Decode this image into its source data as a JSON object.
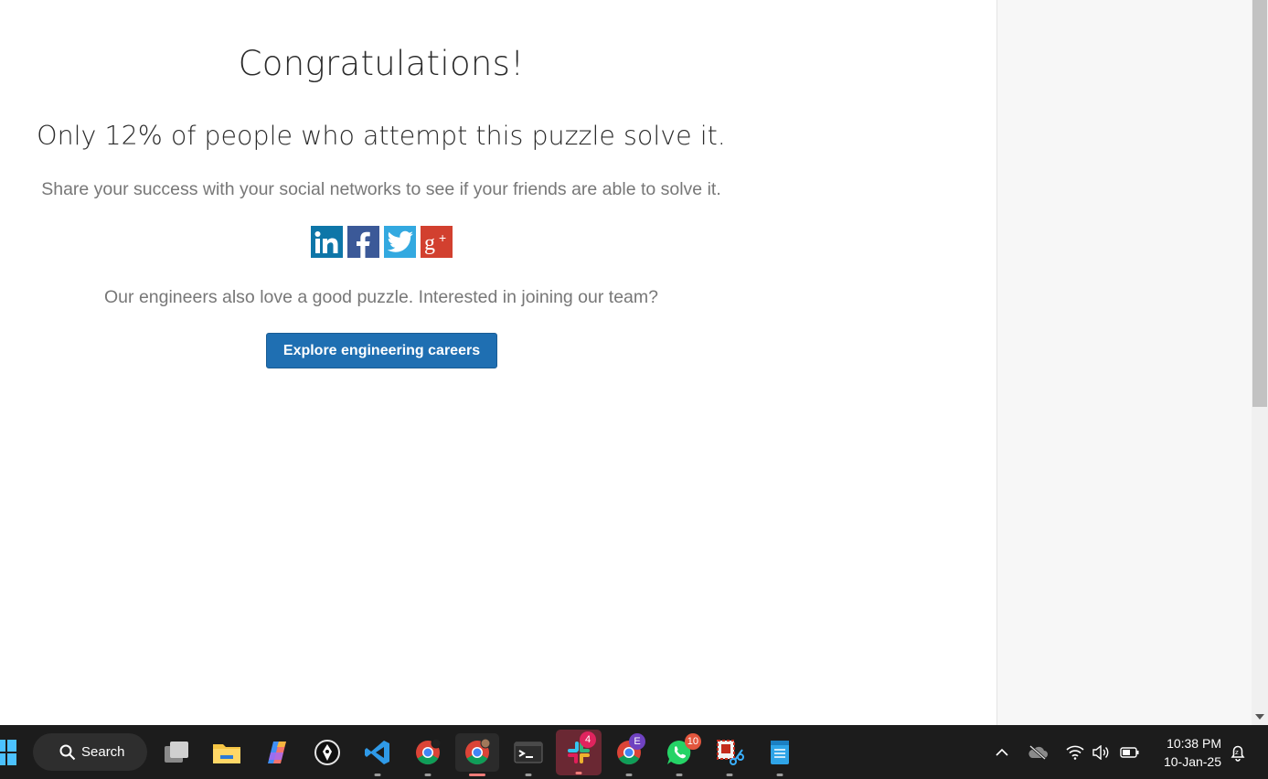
{
  "page": {
    "heading": "Congratulations!",
    "sub_heading": "Only 12% of people who attempt this puzzle solve it.",
    "share_text": "Share your success with your social networks to see if your friends are able to solve it.",
    "team_text": "Our engineers also love a good puzzle. Interested in joining our team?",
    "careers_button": "Explore engineering careers",
    "social": [
      {
        "icon": "linkedin-icon",
        "label": "in",
        "color": "#0e76a8"
      },
      {
        "icon": "facebook-icon",
        "label": "f",
        "color": "#3b5998"
      },
      {
        "icon": "twitter-icon",
        "label": "",
        "color": "#33a9e0"
      },
      {
        "icon": "google-plus-icon",
        "label": "g+",
        "color": "#d2402f"
      }
    ]
  },
  "taskbar": {
    "search_label": "Search",
    "apps": [
      {
        "icon": "task-view-icon"
      },
      {
        "icon": "file-explorer-icon"
      },
      {
        "icon": "copilot-icon"
      },
      {
        "icon": "pen-app-icon"
      },
      {
        "icon": "vscode-icon"
      },
      {
        "icon": "chrome-profile-1-icon"
      },
      {
        "icon": "chrome-profile-2-icon",
        "active": true
      },
      {
        "icon": "terminal-icon"
      },
      {
        "icon": "slack-icon",
        "badge": "4"
      },
      {
        "icon": "chrome-profile-3-icon",
        "badge": "E"
      },
      {
        "icon": "whatsapp-icon",
        "badge": "10"
      },
      {
        "icon": "snipping-tool-icon"
      },
      {
        "icon": "notepad-icon"
      }
    ],
    "clock": {
      "time": "10:38 PM",
      "date": "10-Jan-25"
    }
  },
  "colors": {
    "accent_button": "#1f6fb2",
    "taskbar": "#1c1c1c"
  }
}
